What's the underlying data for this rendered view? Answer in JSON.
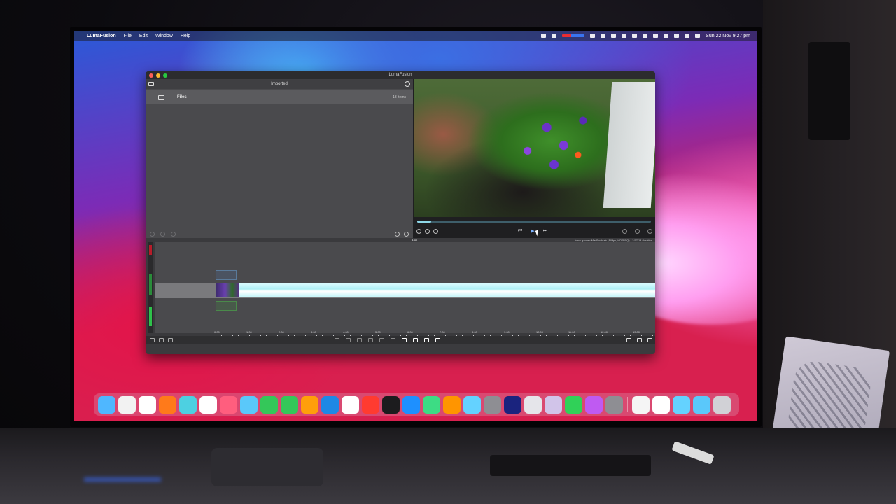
{
  "menubar": {
    "apple": "",
    "app_name": "LumaFusion",
    "items": [
      "File",
      "Edit",
      "Window",
      "Help"
    ],
    "clock": "Sun 22 Nov  9:27 pm"
  },
  "window": {
    "title": "LumaFusion"
  },
  "library": {
    "header_title": "Imported",
    "row_name": "Files",
    "row_count": "13 items"
  },
  "viewer": {
    "scrub_progress": 0.06
  },
  "timeline": {
    "playhead_time": "5.63",
    "meta": "back garden MacBook air (All fps, HDR-PQ) · 1:57.14 duration",
    "ruler": [
      "0:00",
      "1:00",
      "2:00",
      "3:00",
      "4:00",
      "5:00",
      "6:00",
      "7:00",
      "8:00",
      "9:00",
      "10:00",
      "11:00",
      "12:00",
      "13:00"
    ]
  },
  "dock": {
    "colors": [
      "#4fb7ff",
      "#f2f2f2",
      "#ffffff",
      "#ff7a1a",
      "#4dd0e1",
      "#ffffff",
      "#ff5e7e",
      "#5ac8fa",
      "#34c759",
      "#34c759",
      "#ff9f0a",
      "#1e88e5",
      "#ffffff",
      "#ff3b30",
      "#1c1c1e",
      "#1e90ff",
      "#3ddc84",
      "#ff9500",
      "#64d2ff",
      "#8e8e93",
      "#1a237e",
      "#e5e5ea",
      "#d1c4e9",
      "#30d158",
      "#bf5af2",
      "#8e8e93",
      "#f5f5f5",
      "#ffffff",
      "#64d2ff",
      "#5ac8fa",
      "#d1d1d6"
    ]
  }
}
